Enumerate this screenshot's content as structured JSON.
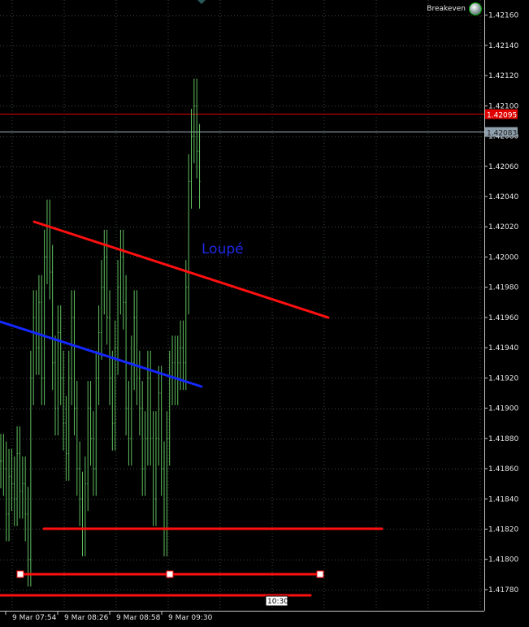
{
  "expert": {
    "name": "Breakeven",
    "icon": "expert-advisor-icon"
  },
  "chart_data": {
    "type": "line",
    "symbol_style": "bar",
    "grid": true,
    "background": "#000000",
    "grid_color": "#3a4a3a",
    "price_color": "#5fbf5f",
    "ylim": [
      1.4176,
      1.4218
    ],
    "y_ticks": [
      "1.42160",
      "1.42140",
      "1.42120",
      "1.42100",
      "1.42080",
      "1.42060",
      "1.42040",
      "1.42020",
      "1.42000",
      "1.41980",
      "1.41960",
      "1.41940",
      "1.41920",
      "1.41900",
      "1.41880",
      "1.41860",
      "1.41840",
      "1.41820",
      "1.41800",
      "1.41780"
    ],
    "x_ticks": [
      "9 Mar 07:54",
      "9 Mar 08:26",
      "9 Mar 08:58",
      "9 Mar 09:30"
    ],
    "time_marker": "10:30",
    "levels": [
      {
        "name": "red-level",
        "price": 1.42095,
        "label": "1.42095",
        "color": "#e00000"
      },
      {
        "name": "current-price",
        "price": 1.42083,
        "label": "1.42083",
        "color": "#a0b4c0"
      }
    ],
    "annotation": {
      "text": "Loupé",
      "color": "#1e28e6"
    },
    "series": [
      {
        "values": [
          1.41865,
          1.4186,
          1.4183,
          1.41855,
          1.4185,
          1.4184,
          1.4187,
          1.41845,
          1.4185,
          1.4183,
          1.418,
          1.4192,
          1.4196,
          1.4194,
          1.4197,
          1.4192,
          1.42,
          1.4202,
          1.4199,
          1.4193,
          1.419,
          1.4195,
          1.4192,
          1.4189,
          1.4187,
          1.4192,
          1.4196,
          1.419,
          1.4186,
          1.4184,
          1.4182,
          1.4185,
          1.419,
          1.4188,
          1.4186,
          1.4192,
          1.4195,
          1.4198,
          1.42,
          1.4196,
          1.4192,
          1.4189,
          1.4194,
          1.4198,
          1.42,
          1.4197,
          1.419,
          1.4188,
          1.4193,
          1.4196,
          1.4192,
          1.419,
          1.4186,
          1.4188,
          1.4192,
          1.4188,
          1.4184,
          1.4188,
          1.4191,
          1.4186,
          1.4182,
          1.4188,
          1.4192,
          1.4193,
          1.4192,
          1.4193,
          1.4194,
          1.4193,
          1.4198,
          1.4205,
          1.4208,
          1.421,
          1.4207,
          1.4205
        ]
      }
    ],
    "trendlines": [
      {
        "name": "descending-red-trendline",
        "color": "#ff1010",
        "width": 3
      },
      {
        "name": "blue-trendline",
        "color": "#1428ff",
        "width": 3
      },
      {
        "name": "support-line",
        "color": "#ff1010",
        "width": 3
      },
      {
        "name": "channel-line",
        "color": "#ff1010",
        "width": 3
      },
      {
        "name": "bottom-line",
        "color": "#ff1010",
        "width": 3
      }
    ]
  }
}
